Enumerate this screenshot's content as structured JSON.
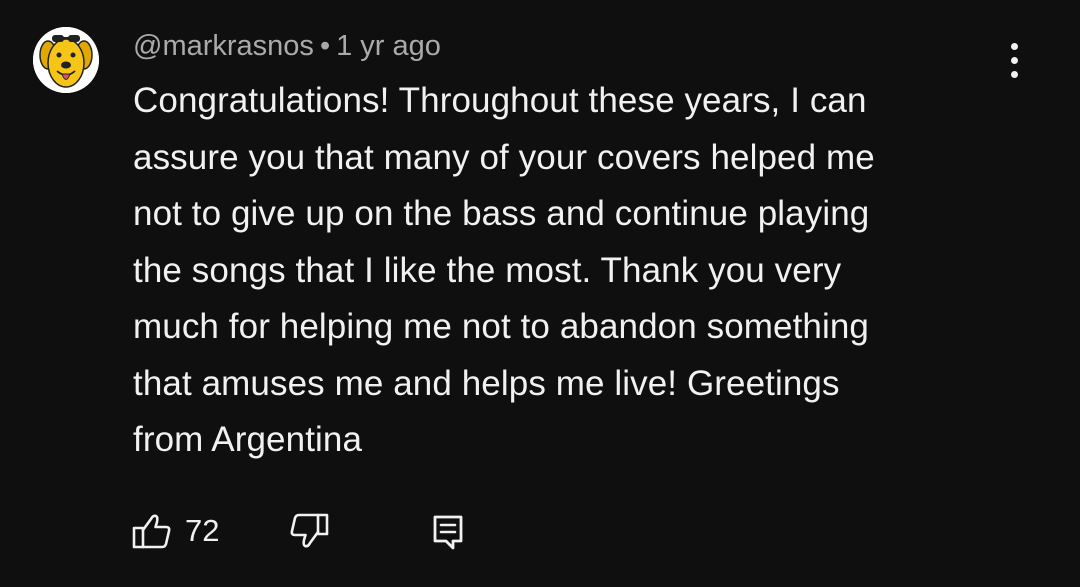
{
  "comment": {
    "author": "@markrasnos",
    "separator": "•",
    "timestamp": "1 yr ago",
    "text": "Congratulations!  Throughout these years, I can\nassure you that many of your covers helped me\nnot to give up on the bass and continue playing\nthe songs that I like the most.  Thank you very\nmuch for helping me not to abandon something\nthat amuses me and helps me live!  Greetings\nfrom Argentina",
    "like_count": "72"
  },
  "icons": {
    "avatar": "dog-avatar-icon",
    "more": "more-vertical-icon",
    "like": "thumbs-up-icon",
    "dislike": "thumbs-down-icon",
    "reply": "reply-comment-icon"
  },
  "colors": {
    "background": "#0f0f0f",
    "primary_text": "#f1f1f1",
    "secondary_text": "#aaaaaa",
    "avatar_yellow": "#f5c518"
  }
}
